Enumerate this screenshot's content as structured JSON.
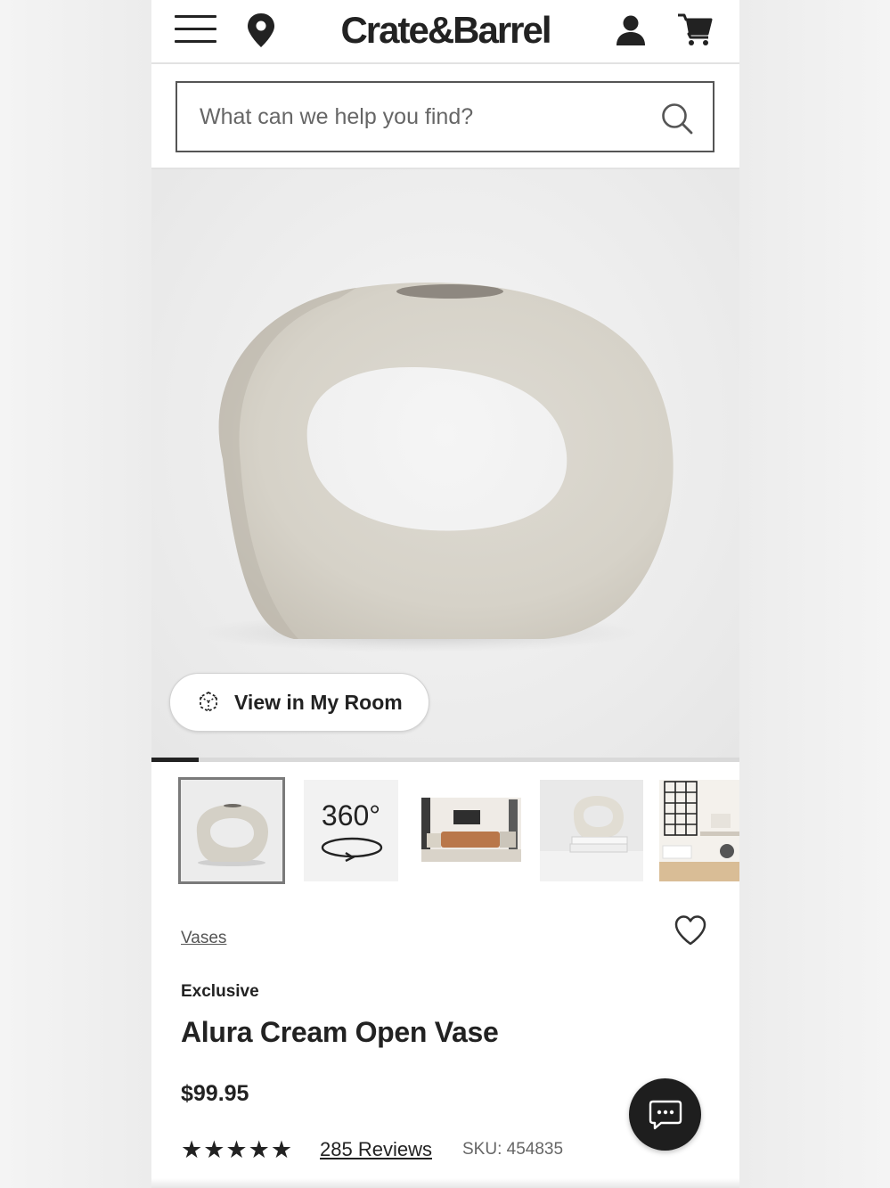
{
  "header": {
    "logo_text": "Crate&Barrel",
    "icons": [
      "hamburger-menu-icon",
      "location-pin-icon",
      "user-icon",
      "cart-icon"
    ]
  },
  "search": {
    "placeholder": "What can we help you find?",
    "value": ""
  },
  "hero": {
    "view_in_room_label": "View in My Room",
    "gallery_progress_fraction": 0.08
  },
  "thumbnails": [
    {
      "kind": "product-photo",
      "selected": true
    },
    {
      "kind": "360-view",
      "label": "360°"
    },
    {
      "kind": "living-room-photo"
    },
    {
      "kind": "styled-vase-photo"
    },
    {
      "kind": "office-room-photo"
    }
  ],
  "product": {
    "category": "Vases",
    "badge": "Exclusive",
    "title": "Alura Cream Open Vase",
    "price": "$99.95",
    "rating_stars": "★★★★★",
    "rating": 5,
    "reviews_label": "285 Reviews",
    "sku": "SKU: 454835"
  },
  "colors": {
    "text": "#222222",
    "background": "#ffffff",
    "vase": "#d9d5cc",
    "chat_button": "#1e1e1e"
  }
}
